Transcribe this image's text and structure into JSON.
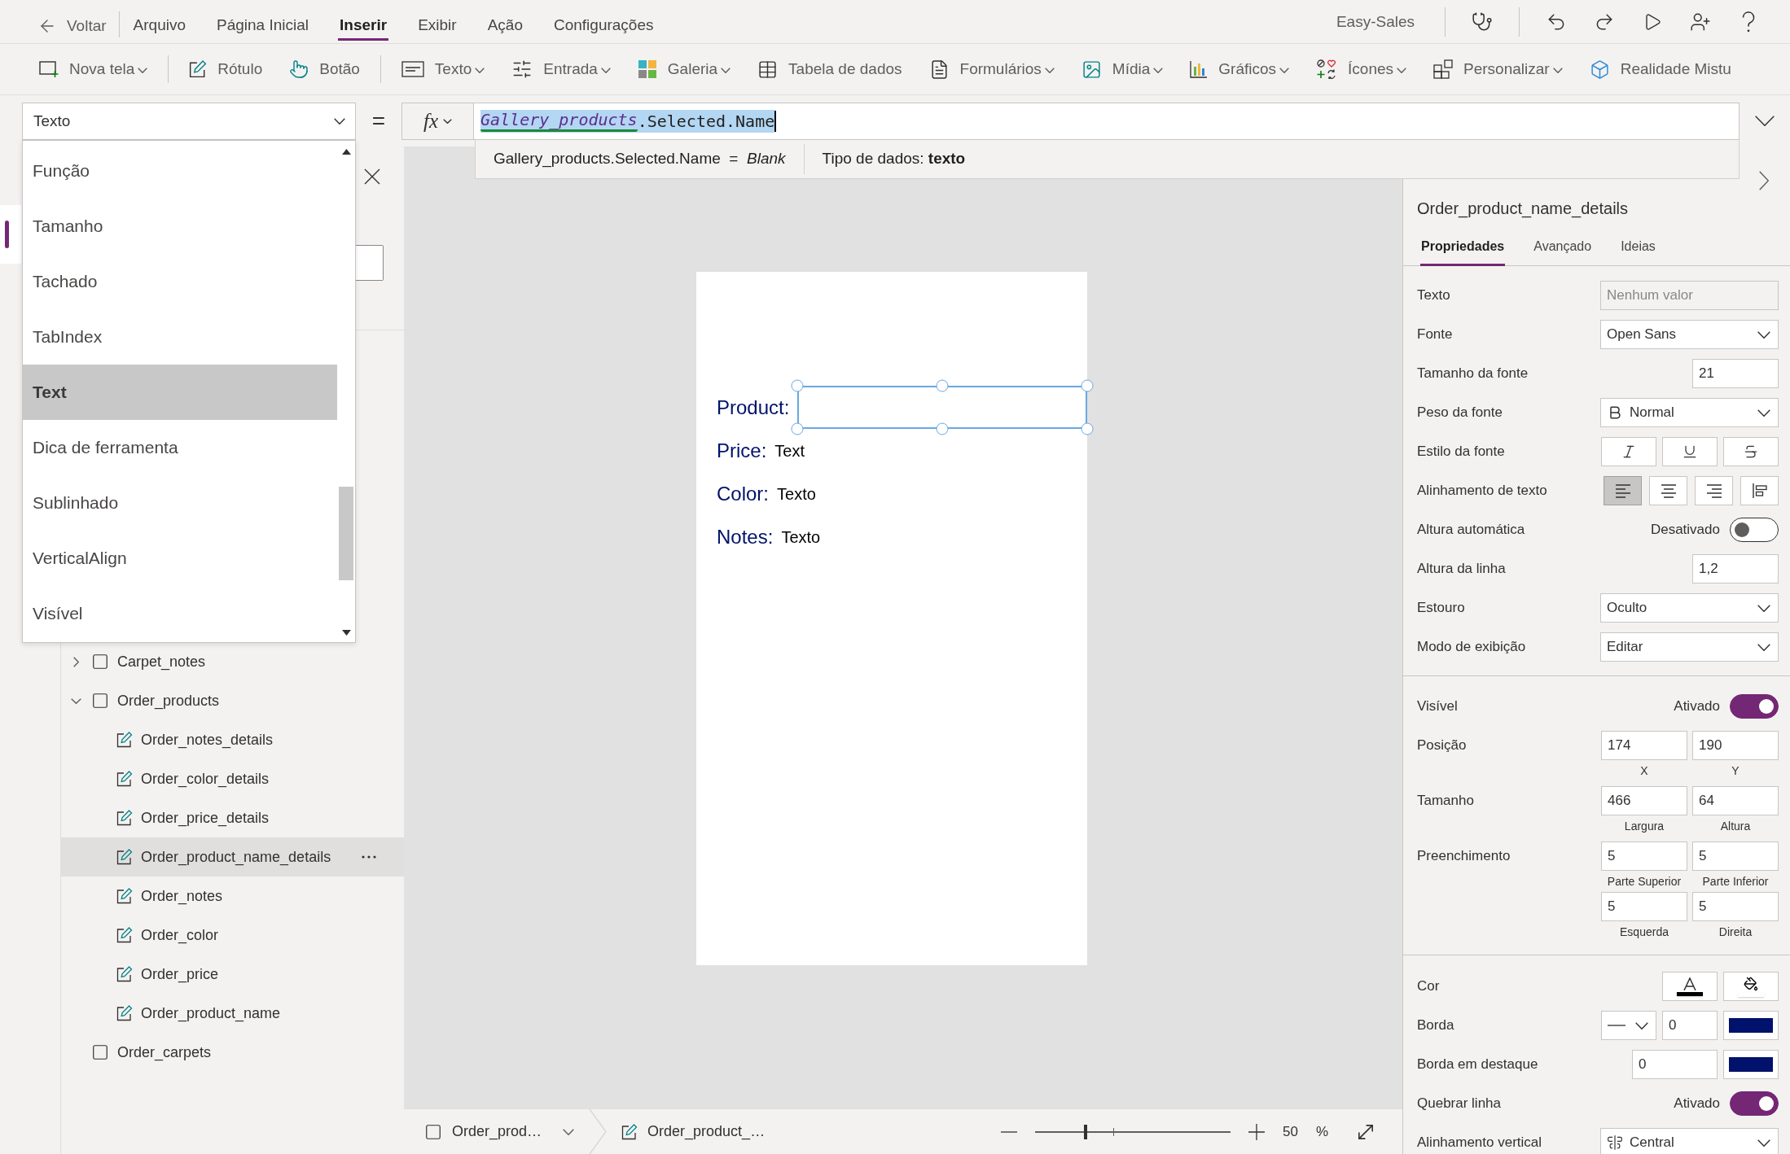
{
  "menu_bar": {
    "back": "Voltar",
    "tabs": [
      {
        "label": "Arquivo",
        "selected": false
      },
      {
        "label": "Página Inicial",
        "selected": false
      },
      {
        "label": "Inserir",
        "selected": true
      },
      {
        "label": "Exibir",
        "selected": false
      },
      {
        "label": "Ação",
        "selected": false
      },
      {
        "label": "Configurações",
        "selected": false
      }
    ],
    "app_name": "Easy-Sales"
  },
  "toolbar": {
    "groups": [
      [
        {
          "label": "Nova tela",
          "kind": "screen",
          "dropdown": true
        }
      ],
      [
        {
          "label": "Rótulo",
          "kind": "label",
          "dropdown": false
        },
        {
          "label": "Botão",
          "kind": "button",
          "dropdown": false
        }
      ],
      [
        {
          "label": "Texto",
          "kind": "text",
          "dropdown": true
        },
        {
          "label": "Entrada",
          "kind": "input",
          "dropdown": true
        },
        {
          "label": "Galeria",
          "kind": "gallery",
          "dropdown": true
        },
        {
          "label": "Tabela de dados",
          "kind": "table",
          "dropdown": false
        },
        {
          "label": "Formulários",
          "kind": "form",
          "dropdown": true
        },
        {
          "label": "Mídia",
          "kind": "media",
          "dropdown": true
        },
        {
          "label": "Gráficos",
          "kind": "chart",
          "dropdown": true
        },
        {
          "label": "Ícones",
          "kind": "icons",
          "dropdown": true
        },
        {
          "label": "Personalizar",
          "kind": "custom",
          "dropdown": true
        },
        {
          "label": "Realidade Mistu",
          "kind": "mixed_reality",
          "dropdown": false
        }
      ]
    ]
  },
  "formula_bar": {
    "property": "Texto",
    "equals": "=",
    "fx": "fx",
    "formula": {
      "selected": true,
      "tokens": [
        {
          "text": "Gallery_products",
          "kind": "identifier"
        },
        {
          "text": ".Selected.Name",
          "kind": "plain"
        }
      ]
    },
    "hint": {
      "result": "Gallery_products.Selected.Name  =  *Blank*",
      "data_type": "Tipo de dados: **texto**"
    }
  },
  "property_list": {
    "items": [
      {
        "label": "Função",
        "selected": false
      },
      {
        "label": "Tamanho",
        "selected": false
      },
      {
        "label": "Tachado",
        "selected": false
      },
      {
        "label": "TabIndex",
        "selected": false
      },
      {
        "label": "Text",
        "selected": true
      },
      {
        "label": "Dica de ferramenta",
        "selected": false
      },
      {
        "label": "Sublinhado",
        "selected": false
      },
      {
        "label": "VerticalAlign",
        "selected": false
      },
      {
        "label": "Visível",
        "selected": false
      }
    ]
  },
  "side_rail": {
    "items": [
      {
        "selected": true
      }
    ]
  },
  "tree_panel": {
    "items": [
      {
        "label": "Carpet_notes",
        "kind": "screen",
        "expanded": false,
        "selected": false
      },
      {
        "label": "Order_products",
        "kind": "screen",
        "expanded": true,
        "selected": false,
        "children": [
          {
            "label": "Order_notes_details",
            "kind": "label",
            "selected": false
          },
          {
            "label": "Order_color_details",
            "kind": "label",
            "selected": false
          },
          {
            "label": "Order_price_details",
            "kind": "label",
            "selected": false
          },
          {
            "label": "Order_product_name_details",
            "kind": "label",
            "selected": true
          },
          {
            "label": "Order_notes",
            "kind": "label",
            "selected": false
          },
          {
            "label": "Order_color",
            "kind": "label",
            "selected": false
          },
          {
            "label": "Order_price",
            "kind": "label",
            "selected": false
          },
          {
            "label": "Order_product_name",
            "kind": "label",
            "selected": false
          }
        ]
      },
      {
        "label": "Order_carpets",
        "kind": "screen",
        "selected": false
      }
    ]
  },
  "canvas": {
    "fields": [
      {
        "label": "Product:",
        "selected": true
      },
      {
        "label": "Price:",
        "value": "Text",
        "selected": false
      },
      {
        "label": "Color:",
        "value": "Texto",
        "selected": false
      },
      {
        "label": "Notes:",
        "value": "Texto",
        "selected": false
      }
    ]
  },
  "status_bar": {
    "screen": "Order_prod…",
    "control": "Order_product_…",
    "zoom": {
      "level": 0.26
    },
    "zoom_value": "50",
    "zoom_unit": "%"
  },
  "properties_panel": {
    "title": "Order_product_name_details",
    "tabs": [
      {
        "label": "Propriedades",
        "selected": true
      },
      {
        "label": "Avançado",
        "selected": false
      },
      {
        "label": "Ideias",
        "selected": false
      }
    ],
    "sections": [
      {
        "rows": [
          {
            "kind": "text",
            "label": "Texto",
            "placeholder": "Nenhum valor"
          },
          {
            "kind": "dropdown",
            "label": "Fonte",
            "value": "Open Sans"
          },
          {
            "kind": "number",
            "label": "Tamanho da fonte",
            "value": "21"
          },
          {
            "kind": "font_weight",
            "label": "Peso da fonte",
            "value": "Normal"
          },
          {
            "kind": "font_style",
            "label": "Estilo da fonte",
            "buttons": [
              {
                "kind": "italic",
                "on": false
              },
              {
                "kind": "underline",
                "on": false
              },
              {
                "kind": "strikethrough",
                "on": false
              }
            ]
          },
          {
            "kind": "text_align",
            "label": "Alinhamento de texto",
            "buttons": [
              {
                "kind": "left",
                "selected": true
              },
              {
                "kind": "center",
                "selected": false
              },
              {
                "kind": "right",
                "selected": false
              },
              {
                "kind": "justify",
                "selected": false
              }
            ]
          },
          {
            "kind": "toggle",
            "label": "Altura automática",
            "state": "Desativado",
            "on": false
          },
          {
            "kind": "number",
            "label": "Altura da linha",
            "value": "1,2"
          },
          {
            "kind": "dropdown",
            "label": "Estouro",
            "value": "Oculto"
          },
          {
            "kind": "dropdown",
            "label": "Modo de exibição",
            "value": "Editar"
          }
        ]
      },
      {
        "rows": [
          {
            "kind": "toggle",
            "label": "Visível",
            "state": "Ativado",
            "on": true
          },
          {
            "kind": "pair",
            "label": "Posição",
            "fields": [
              {
                "value": "174",
                "caption": "X"
              },
              {
                "value": "190",
                "caption": "Y"
              }
            ]
          },
          {
            "kind": "pair",
            "label": "Tamanho",
            "fields": [
              {
                "value": "466",
                "caption": "Largura"
              },
              {
                "value": "64",
                "caption": "Altura"
              }
            ]
          },
          {
            "kind": "pair",
            "label": "Preenchimento",
            "fields": [
              {
                "value": "5",
                "caption": "Parte Superior"
              },
              {
                "value": "5",
                "caption": "Parte Inferior"
              },
              {
                "value": "5",
                "caption": "Esquerda"
              },
              {
                "value": "5",
                "caption": "Direita"
              }
            ]
          }
        ]
      },
      {
        "rows": [
          {
            "kind": "color",
            "label": "Cor",
            "buttons": [
              {
                "kind": "text_color",
                "color": "#000000"
              },
              {
                "kind": "fill",
                "color": "#ffffff"
              }
            ]
          },
          {
            "kind": "border",
            "label": "Borda",
            "value": "0",
            "color": "#00126b"
          },
          {
            "kind": "focus_border",
            "label": "Borda em destaque",
            "value": "0",
            "color": "#00126b"
          },
          {
            "kind": "toggle",
            "label": "Quebrar linha",
            "state": "Ativado",
            "on": true
          },
          {
            "kind": "vertical_align",
            "label": "Alinhamento vertical",
            "value": "Central"
          }
        ]
      }
    ]
  }
}
